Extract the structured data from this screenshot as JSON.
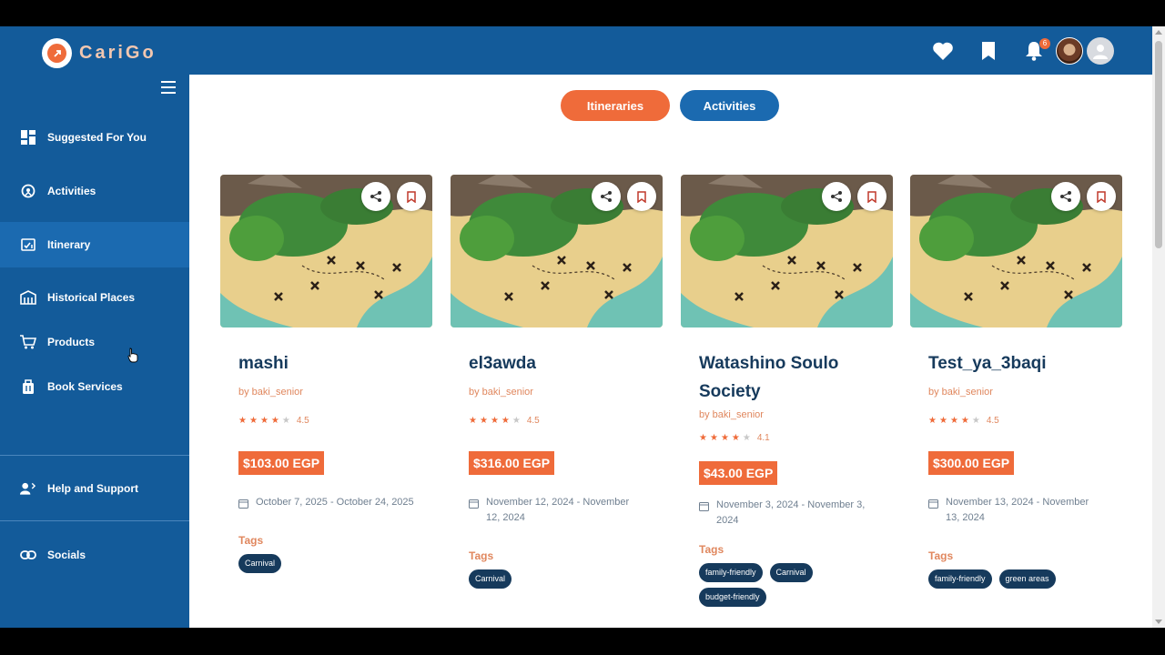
{
  "app": {
    "name": "CariGo"
  },
  "header": {
    "notification_count": "6"
  },
  "sidebar": {
    "items": [
      {
        "label": "Suggested For You",
        "icon": "dashboard-icon"
      },
      {
        "label": "Activities",
        "icon": "activities-icon"
      },
      {
        "label": "Itinerary",
        "icon": "itinerary-icon",
        "active": true
      },
      {
        "label": "Historical Places",
        "icon": "museum-icon"
      },
      {
        "label": "Products",
        "icon": "cart-icon"
      },
      {
        "label": "Book Services",
        "icon": "luggage-icon"
      },
      {
        "label": "Help and Support",
        "icon": "support-icon"
      },
      {
        "label": "Socials",
        "icon": "link-icon"
      }
    ]
  },
  "toggle": {
    "itineraries": "Itineraries",
    "activities": "Activities"
  },
  "tags_label": "Tags",
  "cards": [
    {
      "title": "mashi",
      "author": "by baki_senior",
      "rating": "4.5",
      "stars": 4,
      "price": "$103.00 EGP",
      "dates": "October 7, 2025 - October 24, 2025",
      "tags": [
        "Carnival"
      ]
    },
    {
      "title": "el3awda",
      "author": "by baki_senior",
      "rating": "4.5",
      "stars": 4,
      "price": "$316.00 EGP",
      "dates": "November 12, 2024 - November 12, 2024",
      "tags": [
        "Carnival"
      ]
    },
    {
      "title": "Watashino Soulo Society",
      "author": "by baki_senior",
      "rating": "4.1",
      "stars": 4,
      "price": "$43.00 EGP",
      "dates": "November 3, 2024 - November 3, 2024",
      "tags": [
        "family-friendly",
        "Carnival",
        "budget-friendly"
      ]
    },
    {
      "title": "Test_ya_3baqi",
      "author": "by baki_senior",
      "rating": "4.5",
      "stars": 4,
      "price": "$300.00 EGP",
      "dates": "November 13, 2024 - November 13, 2024",
      "tags": [
        "family-friendly",
        "green areas"
      ]
    }
  ],
  "colors": {
    "brand_blue": "#135b9a",
    "accent_orange": "#ef6b3a",
    "navy": "#163a5c"
  }
}
